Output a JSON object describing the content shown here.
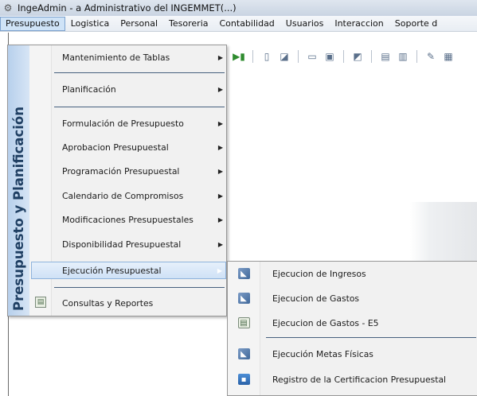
{
  "window": {
    "title": "IngeAdmin -  a Administrativo del INGEMMET(...)",
    "icon": "gear-icon"
  },
  "menubar": {
    "items": [
      "Presupuesto",
      "Logistica",
      "Personal",
      "Tesoreria",
      "Contabilidad",
      "Usuarios",
      "Interaccion",
      "Soporte d"
    ],
    "active": "Presupuesto"
  },
  "dropdown": {
    "side_label": "Presupuesto y Planificación",
    "items": [
      {
        "label": "Mantenimiento de Tablas",
        "submenu": true
      },
      {
        "label": "Planificación",
        "submenu": true
      },
      {
        "label": "Formulación de Presupuesto",
        "submenu": true
      },
      {
        "label": "Aprobacion Presupuestal",
        "submenu": true
      },
      {
        "label": "Programación Presupuestal",
        "submenu": true
      },
      {
        "label": "Calendario de Compromisos",
        "submenu": true
      },
      {
        "label": "Modificaciones Presupuestales",
        "submenu": true
      },
      {
        "label": "Disponibilidad Presupuestal",
        "submenu": true
      },
      {
        "label": "Ejecución Presupuestal",
        "submenu": true,
        "selected": true
      },
      {
        "label": "Consultas y Reportes",
        "submenu": false,
        "icon": "report-icon"
      }
    ]
  },
  "submenu": {
    "items": [
      {
        "label": "Ejecucion de Ingresos",
        "icon": "execution-icon"
      },
      {
        "label": "Ejecucion de Gastos",
        "icon": "execution-icon"
      },
      {
        "label": "Ejecucion de Gastos - E5",
        "icon": "report-icon"
      },
      {
        "label": "Ejecución Metas Físicas",
        "icon": "execution-icon"
      },
      {
        "label": "Registro de la Certificacion Presupuestal",
        "icon": "certificate-icon"
      }
    ]
  },
  "colors": {
    "side_band": "#b7d0ec",
    "side_label": "#1f3f63",
    "selection": "#cfe1f6"
  }
}
